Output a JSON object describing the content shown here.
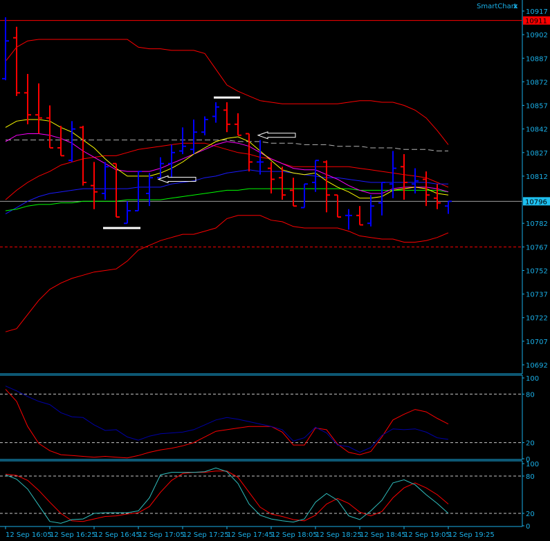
{
  "header": {
    "title": "SmartChart",
    "close_label": "x"
  },
  "colors": {
    "background": "#000000",
    "axis": "#1ab0e8",
    "bull": "#0000ff",
    "bear": "#ff0000",
    "band": "#ff0000",
    "ma_blue": "#1a1aff",
    "ma_green": "#00ff00",
    "ma_magenta": "#ff00ff",
    "ma_yellow": "#ffff00",
    "ma_gray": "#b4b4b4",
    "osc1_main": "#ff0000",
    "osc1_signal": "#0000a8",
    "osc2_main": "#ff0000",
    "osc2_signal": "#30c0c0",
    "level": "#c8c8c8"
  },
  "chart_data": [
    {
      "type": "ohlc",
      "title": "SmartChart",
      "ylim": [
        10692,
        10917
      ],
      "y_tick_labels": [
        "10917",
        "10902",
        "10887",
        "10872",
        "10857",
        "10842",
        "10827",
        "10812",
        "10782",
        "10767",
        "10752",
        "10737",
        "10722",
        "10707",
        "10692"
      ],
      "x_tick_labels": [
        "12 Sep 16:05",
        "12 Sep 16:25",
        "12 Sep 16:45",
        "12 Sep 17:05",
        "12 Sep 17:25",
        "12 Sep 17:45",
        "12 Sep 18:05",
        "12 Sep 18:25",
        "12 Sep 18:45",
        "12 Sep 19:05",
        "12 Sep 19:25"
      ],
      "bar_interval_minutes": 5,
      "bars": [
        [
          10874,
          10913,
          10873,
          10898
        ],
        [
          10900,
          10907,
          10863,
          10865
        ],
        [
          10865,
          10877,
          10845,
          10851
        ],
        [
          10851,
          10871,
          10839,
          10849
        ],
        [
          10849,
          10857,
          10830,
          10830
        ],
        [
          10830,
          10844,
          10825,
          10825
        ],
        [
          10822,
          10847,
          10821,
          10842
        ],
        [
          10843,
          10844,
          10806,
          10808
        ],
        [
          10806,
          10821,
          10791,
          10802
        ],
        [
          10801,
          10821,
          10797,
          10818
        ],
        [
          10820,
          10820,
          10786,
          10786
        ],
        [
          10782,
          10796,
          10782,
          10790
        ],
        [
          10790,
          10815,
          10790,
          10815
        ],
        [
          10801,
          10814,
          10793,
          10811
        ],
        [
          10811,
          10824,
          10811,
          10820
        ],
        [
          10820,
          10832,
          10811,
          10827
        ],
        [
          10828,
          10843,
          10826,
          10831
        ],
        [
          10829,
          10848,
          10826,
          10840
        ],
        [
          10840,
          10850,
          10838,
          10848
        ],
        [
          10850,
          10859,
          10846,
          10856
        ],
        [
          10854,
          10859,
          10840,
          10845
        ],
        [
          10845,
          10852,
          10838,
          10838
        ],
        [
          10839,
          10839,
          10815,
          10821
        ],
        [
          10821,
          10835,
          10813,
          10821
        ],
        [
          10817,
          10821,
          10801,
          10810
        ],
        [
          10811,
          10818,
          10797,
          10800
        ],
        [
          10803,
          10811,
          10793,
          10793
        ],
        [
          10792,
          10807,
          10792,
          10807
        ],
        [
          10808,
          10822,
          10802,
          10822
        ],
        [
          10821,
          10822,
          10789,
          10800
        ],
        [
          10800,
          10800,
          10786,
          10786
        ],
        [
          10787,
          10791,
          10778,
          10787
        ],
        [
          10787,
          10793,
          10781,
          10781
        ],
        [
          10782,
          10800,
          10780,
          10793
        ],
        [
          10795,
          10808,
          10787,
          10808
        ],
        [
          10807,
          10828,
          10798,
          10817
        ],
        [
          10818,
          10826,
          10797,
          10808
        ],
        [
          10807,
          10817,
          10801,
          10809
        ],
        [
          10810,
          10815,
          10793,
          10800
        ],
        [
          10798,
          10807,
          10791,
          10795
        ],
        [
          10793,
          10796,
          10788,
          10796
        ]
      ],
      "series": [
        {
          "name": "upper-outer-band",
          "color_key": "band",
          "values": [
            10885,
            10894,
            10898,
            10899,
            10899,
            10899,
            10899,
            10899,
            10899,
            10899,
            10899,
            10899,
            10894,
            10893,
            10893,
            10892,
            10892,
            10892,
            10890,
            10880,
            10870,
            10866,
            10863,
            10860,
            10859,
            10858,
            10858,
            10858,
            10858,
            10858,
            10858,
            10859,
            10860,
            10860,
            10859,
            10859,
            10857,
            10854,
            10849,
            10841,
            10832
          ]
        },
        {
          "name": "lower-outer-band",
          "color_key": "band",
          "values": [
            10713,
            10715,
            10724,
            10733,
            10740,
            10744,
            10747,
            10749,
            10751,
            10752,
            10753,
            10758,
            10765,
            10768,
            10771,
            10773,
            10775,
            10775,
            10777,
            10779,
            10785,
            10787,
            10787,
            10787,
            10784,
            10783,
            10780,
            10779,
            10779,
            10779,
            10779,
            10777,
            10774,
            10773,
            10772,
            10772,
            10770,
            10770,
            10771,
            10773,
            10776
          ]
        },
        {
          "name": "inner-band",
          "color_key": "band",
          "values": [
            10797,
            10803,
            10808,
            10812,
            10815,
            10819,
            10821,
            10823,
            10824,
            10825,
            10825,
            10827,
            10829,
            10830,
            10831,
            10832,
            10833,
            10833,
            10833,
            10831,
            10829,
            10827,
            10826,
            10824,
            10823,
            10820,
            10818,
            10818,
            10818,
            10818,
            10818,
            10818,
            10817,
            10816,
            10815,
            10814,
            10813,
            10812,
            10811,
            10808,
            10805
          ]
        },
        {
          "name": "blue-ma",
          "color_key": "ma_blue",
          "values": [
            10788,
            10792,
            10796,
            10799,
            10801,
            10802,
            10803,
            10804,
            10804,
            10804,
            10804,
            10804,
            10805,
            10805,
            10805,
            10807,
            10808,
            10809,
            10811,
            10812,
            10814,
            10815,
            10816,
            10815,
            10815,
            10815,
            10814,
            10813,
            10812,
            10811,
            10811,
            10810,
            10809,
            10808,
            10808,
            10808,
            10808,
            10808,
            10808,
            10807,
            10807
          ]
        },
        {
          "name": "green-ma",
          "color_key": "ma_green",
          "values": [
            10790,
            10791,
            10793,
            10794,
            10794,
            10795,
            10795,
            10796,
            10796,
            10796,
            10796,
            10797,
            10797,
            10797,
            10797,
            10798,
            10799,
            10800,
            10801,
            10802,
            10803,
            10803,
            10804,
            10804,
            10804,
            10804,
            10804,
            10804,
            10804,
            10804,
            10804,
            10804,
            10803,
            10803,
            10803,
            10803,
            10803,
            10803,
            10803,
            10803,
            10802
          ]
        },
        {
          "name": "gray-dashed-ma",
          "color_key": "ma_gray",
          "dashed": true,
          "values": [
            10835,
            10835,
            10835,
            10835,
            10835,
            10835,
            10835,
            10835,
            10835,
            10835,
            10835,
            10835,
            10835,
            10835,
            10835,
            10835,
            10835,
            10835,
            10835,
            10835,
            10835,
            10834,
            10834,
            10834,
            10833,
            10833,
            10833,
            10832,
            10832,
            10832,
            10831,
            10831,
            10831,
            10830,
            10830,
            10830,
            10829,
            10829,
            10829,
            10828,
            10828
          ]
        },
        {
          "name": "magenta-ma",
          "color_key": "ma_magenta",
          "values": [
            10834,
            10838,
            10839,
            10839,
            10838,
            10836,
            10833,
            10828,
            10824,
            10820,
            10816,
            10815,
            10815,
            10815,
            10817,
            10820,
            10823,
            10826,
            10829,
            10832,
            10834,
            10833,
            10831,
            10827,
            10823,
            10820,
            10817,
            10816,
            10816,
            10813,
            10810,
            10806,
            10803,
            10801,
            10801,
            10804,
            10805,
            10805,
            10805,
            10804,
            10802
          ]
        },
        {
          "name": "yellow-ma",
          "color_key": "ma_yellow",
          "values": [
            10843,
            10847,
            10848,
            10848,
            10847,
            10843,
            10840,
            10835,
            10830,
            10823,
            10817,
            10812,
            10812,
            10812,
            10814,
            10817,
            10821,
            10826,
            10830,
            10834,
            10836,
            10837,
            10834,
            10828,
            10822,
            10816,
            10814,
            10813,
            10814,
            10809,
            10805,
            10802,
            10798,
            10798,
            10799,
            10803,
            10804,
            10805,
            10804,
            10801,
            10800
          ]
        }
      ],
      "hlines": [
        {
          "name": "high-price-line",
          "price": 10911,
          "label": "10911",
          "color": "#ff0000",
          "style": "solid"
        },
        {
          "name": "current-price-line",
          "price": 10796,
          "label": "10796",
          "color": "#a0a0a0",
          "style": "solid"
        },
        {
          "name": "support-level-line",
          "price": 10767,
          "color": "#ff0000",
          "style": "dashed"
        }
      ],
      "annotations": [
        {
          "type": "bar-marker",
          "from_bar": 19,
          "to_bar": 21,
          "price": 10862
        },
        {
          "type": "bar-marker",
          "from_bar": 9,
          "to_bar": 12,
          "price": 10779
        },
        {
          "type": "arrow-left",
          "from_bar": 23,
          "to_bar": 26,
          "price": 10838
        },
        {
          "type": "arrow-left",
          "from_bar": 14,
          "to_bar": 17,
          "price": 10810
        }
      ]
    },
    {
      "type": "line",
      "title": "oscillator-1",
      "ylim": [
        0,
        100
      ],
      "y_tick_labels": [
        "100",
        "80",
        "20",
        "0"
      ],
      "levels": [
        80,
        20
      ],
      "series": [
        {
          "name": "osc1-main",
          "color_key": "osc1_main",
          "values": [
            86,
            71,
            40,
            19,
            10,
            5,
            4,
            3,
            2,
            3,
            2,
            1,
            4,
            8,
            11,
            13,
            16,
            20,
            27,
            34,
            36,
            38,
            40,
            40,
            40,
            33,
            17,
            17,
            38,
            36,
            18,
            8,
            5,
            9,
            27,
            48,
            55,
            61,
            58,
            50,
            43
          ]
        },
        {
          "name": "osc1-signal",
          "color_key": "osc1_signal",
          "values": [
            90,
            84,
            77,
            71,
            67,
            57,
            52,
            51,
            42,
            35,
            36,
            27,
            23,
            28,
            31,
            32,
            33,
            36,
            42,
            48,
            51,
            49,
            46,
            43,
            40,
            36,
            22,
            26,
            39,
            32,
            17,
            15,
            8,
            14,
            29,
            37,
            36,
            37,
            33,
            26,
            24
          ]
        }
      ]
    },
    {
      "type": "line",
      "title": "oscillator-2",
      "ylim": [
        0,
        100
      ],
      "y_tick_labels": [
        "100",
        "80",
        "20",
        "0"
      ],
      "levels": [
        80,
        20
      ],
      "series": [
        {
          "name": "osc2-main",
          "color_key": "osc2_main",
          "values": [
            83,
            81,
            73,
            57,
            38,
            20,
            8,
            7,
            11,
            15,
            16,
            19,
            21,
            31,
            54,
            73,
            84,
            86,
            86,
            88,
            88,
            78,
            54,
            30,
            19,
            15,
            10,
            8,
            17,
            35,
            44,
            36,
            22,
            16,
            23,
            45,
            61,
            69,
            61,
            50,
            35
          ]
        },
        {
          "name": "osc2-signal",
          "color_key": "osc2_signal",
          "values": [
            82,
            75,
            59,
            33,
            7,
            4,
            10,
            11,
            20,
            21,
            21,
            21,
            24,
            45,
            82,
            86,
            86,
            86,
            87,
            93,
            87,
            68,
            35,
            17,
            11,
            8,
            6,
            11,
            38,
            52,
            41,
            16,
            10,
            24,
            41,
            69,
            74,
            66,
            50,
            36,
            20
          ]
        }
      ]
    }
  ]
}
